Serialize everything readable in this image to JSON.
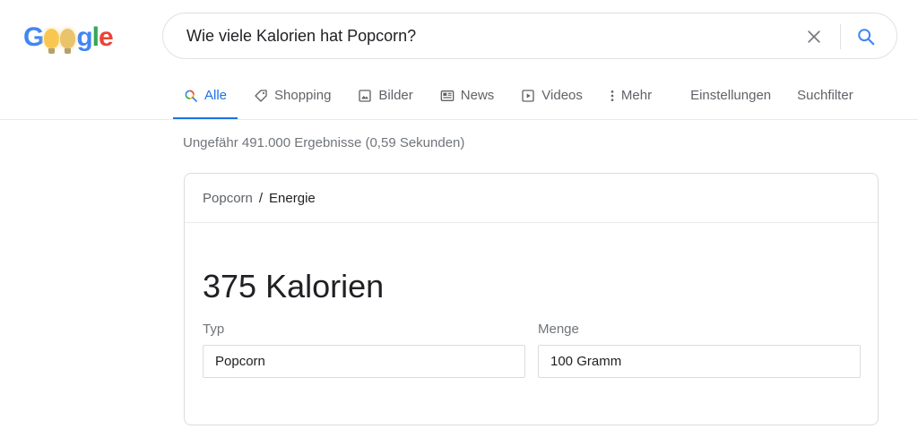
{
  "logo": {
    "letters": [
      "G",
      "g",
      "l",
      "e"
    ],
    "alt": "Google"
  },
  "search": {
    "query": "Wie viele Kalorien hat Popcorn?",
    "clear_icon": "close-icon",
    "submit_icon": "search-icon"
  },
  "tabs": [
    {
      "label": "Alle",
      "icon": "search-icon",
      "active": true
    },
    {
      "label": "Shopping",
      "icon": "tag-icon"
    },
    {
      "label": "Bilder",
      "icon": "image-icon"
    },
    {
      "label": "News",
      "icon": "newspaper-icon"
    },
    {
      "label": "Videos",
      "icon": "play-icon"
    },
    {
      "label": "Mehr",
      "icon": "more-vert-icon"
    }
  ],
  "tools": {
    "settings": "Einstellungen",
    "filter": "Suchfilter"
  },
  "stats": "Ungefähr 491.000 Ergebnisse (0,59 Sekunden)",
  "card": {
    "breadcrumb": {
      "parent": "Popcorn",
      "separator": "/",
      "current": "Energie"
    },
    "result": "375 Kalorien",
    "fields": [
      {
        "label": "Typ",
        "value": "Popcorn"
      },
      {
        "label": "Menge",
        "value": "100 Gramm"
      }
    ]
  },
  "colors": {
    "accent": "#1a73e8",
    "text": "#202124",
    "muted": "#70757a",
    "border": "#dadce0"
  }
}
